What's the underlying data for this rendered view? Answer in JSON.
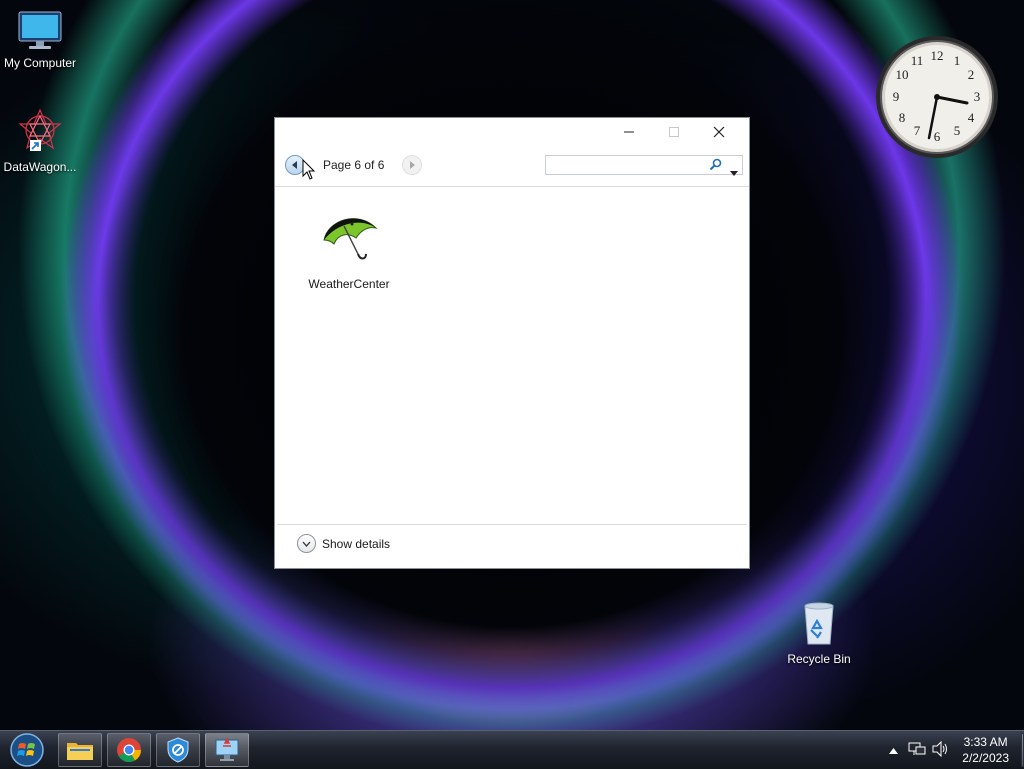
{
  "desktop": {
    "icons": [
      {
        "label": "My Computer",
        "icon": "monitor-icon"
      },
      {
        "label": "DataWagon...",
        "icon": "spirograph-shortcut-icon"
      },
      {
        "label": "Recycle Bin",
        "icon": "recycle-bin-icon"
      }
    ]
  },
  "window": {
    "controls": {
      "minimize": "minimize-icon",
      "maximize": "maximize-icon",
      "close": "close-icon"
    },
    "nav": {
      "page_label": "Page 6 of 6"
    },
    "search": {
      "value": "",
      "placeholder": ""
    },
    "items": [
      {
        "label": "WeatherCenter",
        "icon": "umbrella-icon"
      }
    ],
    "details_label": "Show details"
  },
  "clock_gadget": {
    "time_shown": "3:33",
    "numerals": [
      "12",
      "1",
      "2",
      "3",
      "4",
      "5",
      "6",
      "7",
      "8",
      "9",
      "10",
      "11"
    ]
  },
  "taskbar": {
    "start": "windows-start-icon",
    "pinned": [
      "file-explorer-icon",
      "chrome-icon",
      "shield-icon",
      "network-monitor-icon"
    ],
    "tray": {
      "time": "3:33 AM",
      "date": "2/2/2023"
    }
  },
  "colors": {
    "accent": "#3a8fd6",
    "window_border": "#8a8f99",
    "taskbar": "#1e232d"
  }
}
